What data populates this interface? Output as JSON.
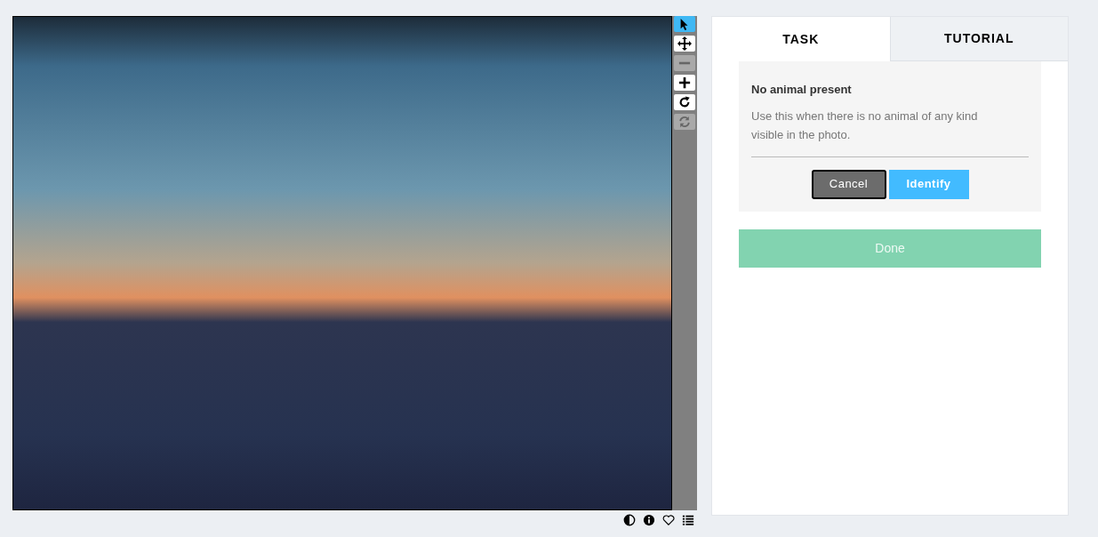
{
  "viewer": {
    "tools": [
      {
        "kind": "select",
        "selected": true,
        "disabled": false
      },
      {
        "kind": "move",
        "selected": false,
        "disabled": false
      },
      {
        "kind": "zoom-out",
        "selected": false,
        "disabled": true
      },
      {
        "kind": "zoom-in",
        "selected": false,
        "disabled": false
      },
      {
        "kind": "rotate",
        "selected": false,
        "disabled": false
      },
      {
        "kind": "reset",
        "selected": false,
        "disabled": true
      }
    ],
    "actions": [
      {
        "kind": "invert"
      },
      {
        "kind": "info"
      },
      {
        "kind": "favourite"
      },
      {
        "kind": "metadata"
      }
    ]
  },
  "tabs": [
    {
      "label": "TASK",
      "selected": true
    },
    {
      "label": "TUTORIAL",
      "selected": false
    }
  ],
  "answer": {
    "title": "No animal present",
    "description": "Use this when there is no animal of any kind visible in the photo.",
    "buttons": [
      {
        "label": "Cancel",
        "kind": "cancel"
      },
      {
        "label": "Identify",
        "kind": "confirm"
      }
    ]
  },
  "done": {
    "label": "Done",
    "disabled": true
  }
}
